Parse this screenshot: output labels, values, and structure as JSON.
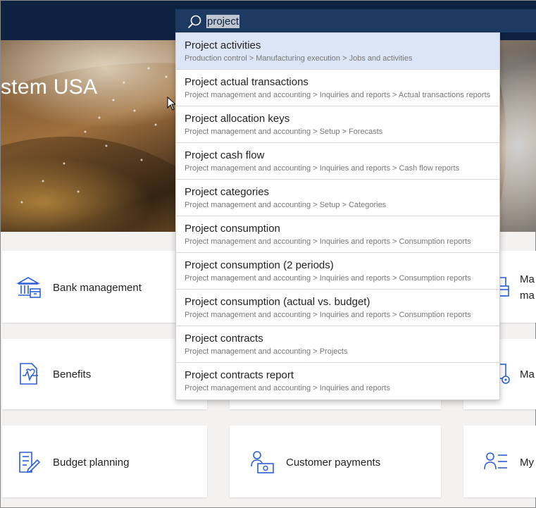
{
  "search": {
    "value": "project"
  },
  "hero": {
    "title": "stem USA"
  },
  "tiles": {
    "bank": "Bank management",
    "benefits": "Benefits",
    "budget": "Budget planning",
    "customer_payments": "Customer payments",
    "right_top_line1": "Ma",
    "right_top_line2": "ma",
    "right_mid": "Ma",
    "right_bottom": "My"
  },
  "results": [
    {
      "title": "Project activities",
      "path": "Production control > Manufacturing execution > Jobs and activities",
      "selected": true
    },
    {
      "title": "Project actual transactions",
      "path": "Project management and accounting > Inquiries and reports > Actual transactions reports"
    },
    {
      "title": "Project allocation keys",
      "path": "Project management and accounting > Setup > Forecasts"
    },
    {
      "title": "Project cash flow",
      "path": "Project management and accounting > Inquiries and reports > Cash flow reports"
    },
    {
      "title": "Project categories",
      "path": "Project management and accounting > Setup > Categories"
    },
    {
      "title": "Project consumption",
      "path": "Project management and accounting > Inquiries and reports > Consumption reports"
    },
    {
      "title": "Project consumption (2 periods)",
      "path": "Project management and accounting > Inquiries and reports > Consumption reports"
    },
    {
      "title": "Project consumption (actual vs. budget)",
      "path": "Project management and accounting > Inquiries and reports > Consumption reports"
    },
    {
      "title": "Project contracts",
      "path": "Project management and accounting > Projects"
    },
    {
      "title": "Project contracts report",
      "path": "Project management and accounting > Inquiries and reports"
    }
  ],
  "colors": {
    "accent": "#2b5fd9",
    "topbar": "#0d2141",
    "selected_row": "#dbe5f6"
  }
}
